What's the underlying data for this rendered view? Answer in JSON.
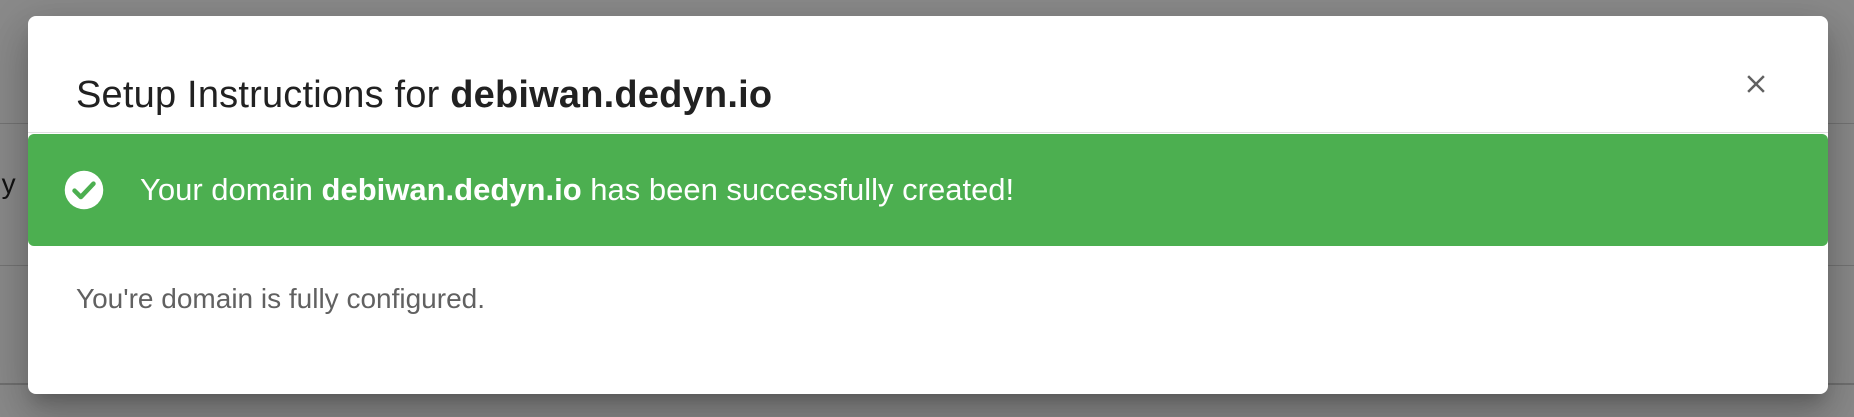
{
  "background": {
    "partial_text": "dy"
  },
  "dialog": {
    "title_prefix": "Setup Instructions for ",
    "title_domain": "debiwan.dedyn.io",
    "close_icon": "close-icon",
    "alert": {
      "icon": "check-circle-icon",
      "text_prefix": "Your domain ",
      "text_domain": "debiwan.dedyn.io",
      "text_suffix": " has been successfully created!",
      "color": "#4caf50"
    },
    "body_text": "You're domain is fully configured."
  }
}
